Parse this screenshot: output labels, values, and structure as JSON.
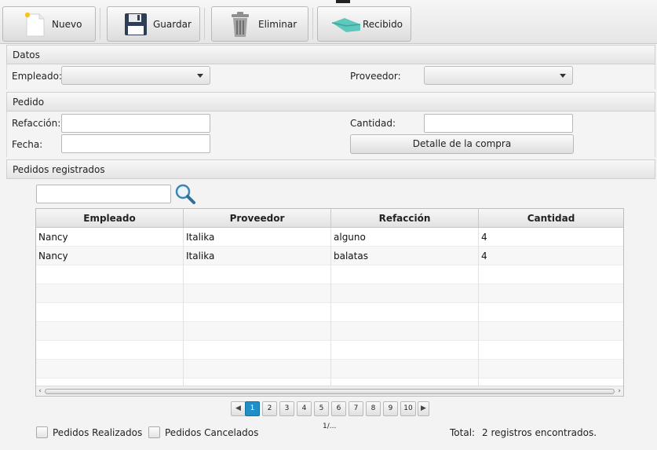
{
  "toolbar": {
    "buttons": [
      {
        "label": "Nuevo",
        "icon": "new-document-icon"
      },
      {
        "label": "Guardar",
        "icon": "floppy-disk-icon"
      },
      {
        "label": "Eliminar",
        "icon": "trash-can-icon"
      },
      {
        "label": "Recibido",
        "icon": "received-icon"
      }
    ]
  },
  "datos": {
    "title": "Datos",
    "empleado_label": "Empleado:",
    "empleado_value": "",
    "proveedor_label": "Proveedor:",
    "proveedor_value": ""
  },
  "pedido": {
    "title": "Pedido",
    "refaccion_label": "Refacción:",
    "refaccion_value": "",
    "cantidad_label": "Cantidad:",
    "cantidad_value": "",
    "fecha_label": "Fecha:",
    "fecha_value": "",
    "detalle_button": "Detalle de la compra"
  },
  "registrados": {
    "title": "Pedidos registrados",
    "search_value": "",
    "columns": [
      "Empleado",
      "Proveedor",
      "Refacción",
      "Cantidad"
    ],
    "rows": [
      [
        "Nancy",
        "Italika",
        "alguno",
        "4"
      ],
      [
        "Nancy",
        "Italika",
        "balatas",
        "4"
      ]
    ]
  },
  "pagination": {
    "pages": [
      "1",
      "2",
      "3",
      "4",
      "5",
      "6",
      "7",
      "8",
      "9",
      "10"
    ],
    "current": "1",
    "page_indicator": "1/..."
  },
  "footer": {
    "realizados_label": "Pedidos Realizados",
    "cancelados_label": "Pedidos Cancelados",
    "total_label": "Total:",
    "total_value": "2 registros encontrados."
  },
  "colors": {
    "accent": "#1f8ec9",
    "background": "#f3f3f3"
  }
}
